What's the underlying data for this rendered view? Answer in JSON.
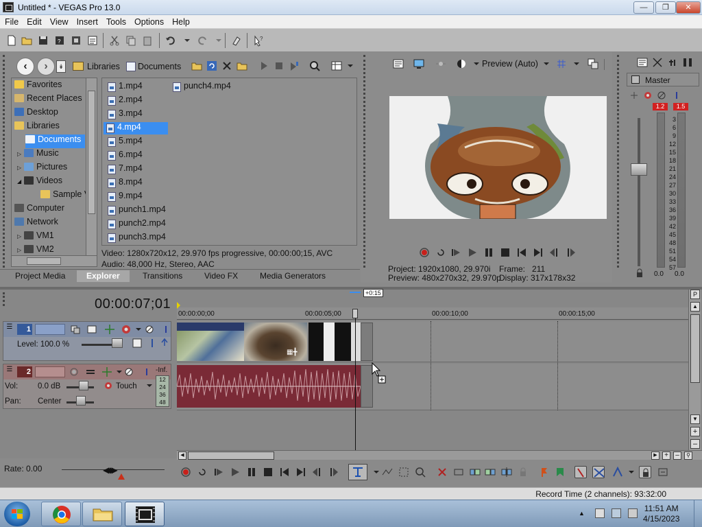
{
  "window": {
    "title": "Untitled * - VEGAS Pro 13.0"
  },
  "menu": [
    "File",
    "Edit",
    "View",
    "Insert",
    "Tools",
    "Options",
    "Help"
  ],
  "explorer": {
    "breadcrumb": [
      "Libraries",
      "Documents"
    ],
    "tree": [
      {
        "label": "Favorites"
      },
      {
        "label": "Recent Places"
      },
      {
        "label": "Desktop"
      },
      {
        "label": "Libraries"
      },
      {
        "label": "Documents"
      },
      {
        "label": "Music"
      },
      {
        "label": "Pictures"
      },
      {
        "label": "Videos"
      },
      {
        "label": "Sample V"
      },
      {
        "label": "Computer"
      },
      {
        "label": "Network"
      },
      {
        "label": "VM1"
      },
      {
        "label": "VM2"
      }
    ],
    "files": [
      "1.mp4",
      "2.mp4",
      "3.mp4",
      "4.mp4",
      "5.mp4",
      "6.mp4",
      "7.mp4",
      "8.mp4",
      "9.mp4",
      "punch1.mp4",
      "punch2.mp4",
      "punch3.mp4",
      "punch4.mp4"
    ],
    "selected_file": "4.mp4",
    "file_info_video": "Video: 1280x720x12, 29.970 fps progressive, 00:00:00;15, AVC",
    "file_info_audio": "Audio: 48,000 Hz, Stereo, AAC",
    "tabs": [
      "Project Media",
      "Explorer",
      "Transitions",
      "Video FX",
      "Media Generators"
    ],
    "active_tab": "Explorer"
  },
  "preview": {
    "mode": "Preview (Auto)",
    "project_label": "Project:",
    "project_value": "1920x1080, 29.970i",
    "frame_label": "Frame:",
    "frame_value": "211",
    "preview_label": "Preview:",
    "preview_value": "480x270x32, 29.970p",
    "display_label": "Display:",
    "display_value": "317x178x32"
  },
  "master": {
    "title": "Master",
    "peak_left": "1.2",
    "peak_right": "1.5",
    "scale": [
      "3",
      "6",
      "9",
      "12",
      "15",
      "18",
      "21",
      "24",
      "27",
      "30",
      "33",
      "36",
      "39",
      "42",
      "45",
      "48",
      "51",
      "54",
      "57"
    ],
    "value_left": "0.0",
    "value_right": "0.0"
  },
  "timeline": {
    "timecode": "00:00:07;01",
    "cursor_offset": "+0:15",
    "ruler": [
      "00:00:00;00",
      "00:00:05;00",
      "00:00:10;00",
      "00:00:15;00"
    ],
    "video_track": {
      "number": "1",
      "level_label": "Level: 100.0 %"
    },
    "audio_track": {
      "number": "2",
      "inf_label": "-Inf.",
      "vol_label": "Vol:",
      "vol_value": "0.0 dB",
      "pan_label": "Pan:",
      "pan_value": "Center",
      "mode": "Touch",
      "meter_scale": [
        "12",
        "24",
        "36",
        "48"
      ]
    },
    "rate_label": "Rate: 0.00"
  },
  "status": {
    "record_time": "Record Time (2 channels): 93:32:00"
  },
  "clock": {
    "time": "11:51 AM",
    "date": "4/15/2023"
  },
  "colors": {
    "selection": "#3b8ef0",
    "audio_clip": "#7a2a36",
    "peak": "#d12020",
    "preview_bg": "#f0f0f0"
  }
}
